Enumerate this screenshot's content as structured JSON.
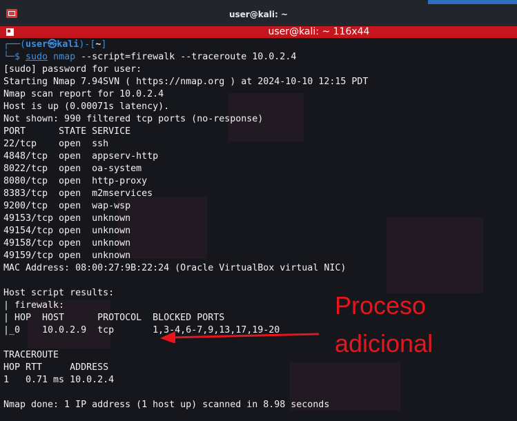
{
  "window": {
    "title": "user@kali: ~",
    "tab_title": "user@kali: ~ 116x44"
  },
  "prompt": {
    "top_prefix": "┌──(",
    "user": "user",
    "at": "㉿",
    "host": "kali",
    "mid": ")-[",
    "dir": "~",
    "close": "]",
    "bottom_prefix": "└─",
    "dollar": "$ ",
    "sudo": "sudo",
    "nmap": "nmap",
    "args": " --script=firewalk --traceroute 10.0.2.4"
  },
  "output": [
    "[sudo] password for user:",
    "Starting Nmap 7.94SVN ( https://nmap.org ) at 2024-10-10 12:15 PDT",
    "Nmap scan report for 10.0.2.4",
    "Host is up (0.00071s latency).",
    "Not shown: 990 filtered tcp ports (no-response)",
    "PORT      STATE SERVICE",
    "22/tcp    open  ssh",
    "4848/tcp  open  appserv-http",
    "8022/tcp  open  oa-system",
    "8080/tcp  open  http-proxy",
    "8383/tcp  open  m2mservices",
    "9200/tcp  open  wap-wsp",
    "49153/tcp open  unknown",
    "49154/tcp open  unknown",
    "49158/tcp open  unknown",
    "49159/tcp open  unknown",
    "MAC Address: 08:00:27:9B:22:24 (Oracle VirtualBox virtual NIC)",
    "",
    "Host script results:",
    "| firewalk:",
    "| HOP  HOST      PROTOCOL  BLOCKED PORTS",
    "|_0    10.0.2.9  tcp       1,3-4,6-7,9,13,17,19-20",
    "",
    "TRACEROUTE",
    "HOP RTT     ADDRESS",
    "1   0.71 ms 10.0.2.4",
    "",
    "Nmap done: 1 IP address (1 host up) scanned in 8.98 seconds"
  ],
  "annotation": {
    "text": "Proceso\nadicional",
    "color": "#e8161c"
  }
}
